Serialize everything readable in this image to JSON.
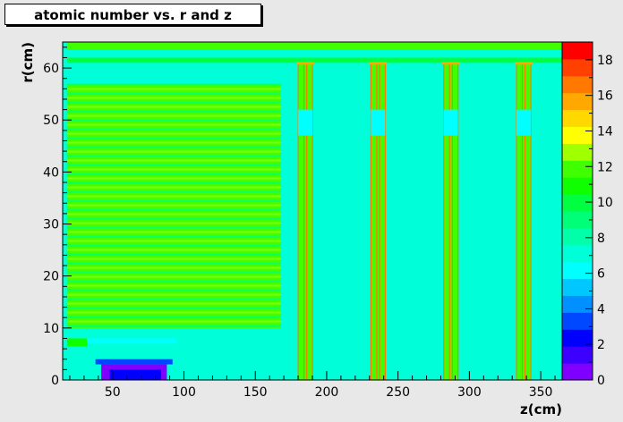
{
  "title": "atomic number vs. r and z",
  "chart_data": {
    "type": "heatmap",
    "title": "atomic number vs. r and z",
    "xlabel": "z(cm)",
    "ylabel": "r(cm)",
    "xlim": [
      15,
      365
    ],
    "ylim": [
      0,
      65
    ],
    "x_ticks": [
      50,
      100,
      150,
      200,
      250,
      300,
      350
    ],
    "y_ticks": [
      0,
      10,
      20,
      30,
      40,
      50,
      60
    ],
    "colorbar": {
      "range": [
        0,
        19
      ],
      "ticks": [
        0,
        2,
        4,
        6,
        8,
        10,
        12,
        14,
        16,
        18
      ],
      "palette": [
        "#7f00ff",
        "#3c00ff",
        "#0000ff",
        "#0048ff",
        "#0090ff",
        "#00c8ff",
        "#00ffff",
        "#00ffd8",
        "#00ffa8",
        "#00ff78",
        "#00ff40",
        "#10ff00",
        "#40ff00",
        "#a0ff00",
        "#ffff00",
        "#ffd800",
        "#ffa800",
        "#ff7800",
        "#ff4000",
        "#ff0000"
      ]
    },
    "background_value": 7,
    "regions": [
      {
        "z": [
          18,
          168
        ],
        "r": [
          10,
          57
        ],
        "value": 11.5,
        "structure": "layered"
      },
      {
        "z": [
          18,
          32
        ],
        "r": [
          6.5,
          8
        ],
        "value": 11
      },
      {
        "z": [
          32,
          95
        ],
        "r": [
          7,
          8
        ],
        "value": 6
      },
      {
        "z": [
          38,
          92
        ],
        "r": [
          3,
          4
        ],
        "value": 3
      },
      {
        "z": [
          42,
          88
        ],
        "r": [
          0,
          3
        ],
        "value": 0
      },
      {
        "z": [
          48,
          84
        ],
        "r": [
          0,
          2
        ],
        "value": 2
      },
      {
        "z": [
          18,
          365
        ],
        "r": [
          63.5,
          65
        ],
        "value": 12
      },
      {
        "z": [
          18,
          365
        ],
        "r": [
          61,
          62
        ],
        "value": 10
      }
    ],
    "columns": [
      {
        "z": [
          180,
          190
        ],
        "r": [
          0,
          61
        ],
        "value": 12
      },
      {
        "z": [
          231,
          241
        ],
        "r": [
          0,
          61
        ],
        "value": 12
      },
      {
        "z": [
          282,
          292
        ],
        "r": [
          0,
          61
        ],
        "value": 12
      },
      {
        "z": [
          333,
          343
        ],
        "r": [
          0,
          61
        ],
        "value": 12
      }
    ]
  }
}
